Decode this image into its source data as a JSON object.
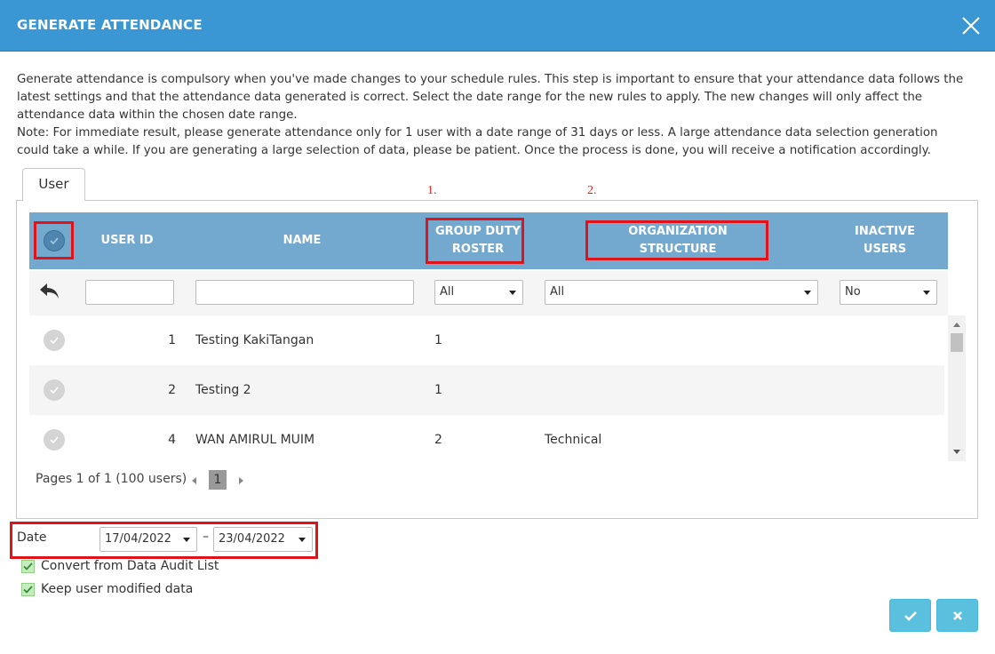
{
  "dialog": {
    "title": "GENERATE ATTENDANCE"
  },
  "intro": {
    "line1": "Generate attendance is compulsory when you've made changes to your schedule rules. This step is important to ensure that your attendance data follows the",
    "line2": "latest settings and that the attendance data generated is correct. Select the date range for the new rules to apply. The new changes will only affect the",
    "line3": "attendance data within the chosen date range.",
    "line4": "Note: For immediate result, please generate attendance only for 1 user with a date range of 31 days or less. A large attendance data selection generation",
    "line5": "could take a while. If you are generating a large selection of data, please be patient. Once the process is done, you will receive a notification accordingly."
  },
  "tabs": [
    {
      "label": "User",
      "active": true
    }
  ],
  "markers": {
    "one": "1.",
    "two": "2."
  },
  "table": {
    "headers": {
      "user_id": "USER ID",
      "name": "NAME",
      "group_duty_roster_1": "GROUP DUTY",
      "group_duty_roster_2": "ROSTER",
      "organization_structure": "ORGANIZATION STRUCTURE",
      "inactive_users_1": "INACTIVE",
      "inactive_users_2": "USERS"
    },
    "filters": {
      "user_id": "",
      "name": "",
      "group_duty_roster": "All",
      "organization_structure": "All",
      "inactive_users": "No"
    },
    "rows": [
      {
        "user_id": "1",
        "name": "Testing KakiTangan",
        "roster": "1",
        "org": ""
      },
      {
        "user_id": "2",
        "name": "Testing 2",
        "roster": "1",
        "org": ""
      },
      {
        "user_id": "4",
        "name": "WAN AMIRUL MUIM",
        "roster": "2",
        "org": "Technical"
      }
    ]
  },
  "pager": {
    "summary": "Pages 1 of 1 (100 users)",
    "current": "1"
  },
  "date": {
    "label": "Date",
    "from": "17/04/2022",
    "separator": "–",
    "to": "23/04/2022"
  },
  "options": {
    "convert_label": "Convert from Data Audit List",
    "convert_checked": true,
    "keep_label": "Keep user modified data",
    "keep_checked": true
  },
  "colors": {
    "titlebar": "#3a97d4",
    "table_header": "#74a9cf",
    "highlight": "#e0131b",
    "action_button": "#5bc0de"
  }
}
